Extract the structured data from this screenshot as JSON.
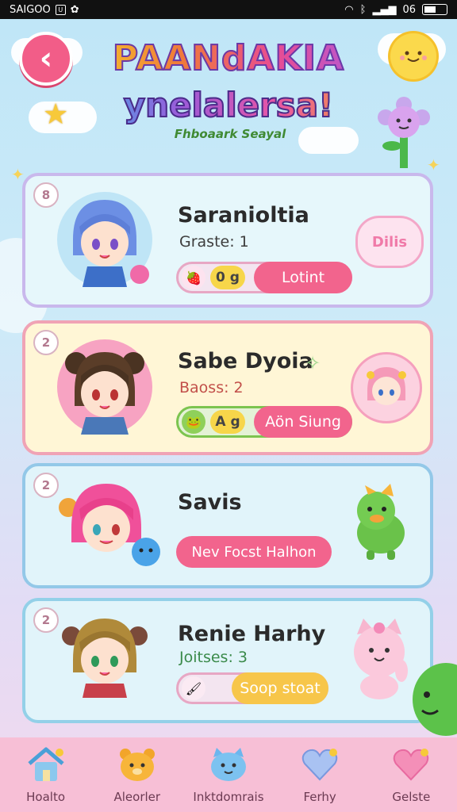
{
  "status_bar": {
    "carrier": "SAIGOO",
    "time": "06",
    "left_icon": "U"
  },
  "header": {
    "title_line1": "PAANdAKIA",
    "title_line2": "ynelalersa!",
    "subtitle": "Fhboaark Seayal"
  },
  "cards": [
    {
      "rank": "8",
      "name": "Saranioltia",
      "stat": "Graste: 1",
      "amount": "0 g",
      "action": "Lotint",
      "bubble_text": "Dilis"
    },
    {
      "rank": "2",
      "name": "Sabe Dyoia",
      "stat": "Baoss: 2",
      "amount": "A g",
      "action": "Aön Siung"
    },
    {
      "rank": "2",
      "name": "Savis",
      "action": "Nev Focst Halhon"
    },
    {
      "rank": "2",
      "name": "Renie Harhy",
      "stat": "Joitses: 3",
      "action": "Soop stoat"
    }
  ],
  "tabs": [
    {
      "label": "Hoalto",
      "icon": "house-icon"
    },
    {
      "label": "Aleorler",
      "icon": "bear-icon"
    },
    {
      "label": "Inktdomrais",
      "icon": "cat-icon"
    },
    {
      "label": "Ferhy",
      "icon": "heart-icon"
    },
    {
      "label": "Gelste",
      "icon": "pink-heart-icon"
    }
  ],
  "colors": {
    "accent_pink": "#f2648d",
    "tab_bar": "#f7bfd6",
    "gold": "#f7d64a"
  }
}
